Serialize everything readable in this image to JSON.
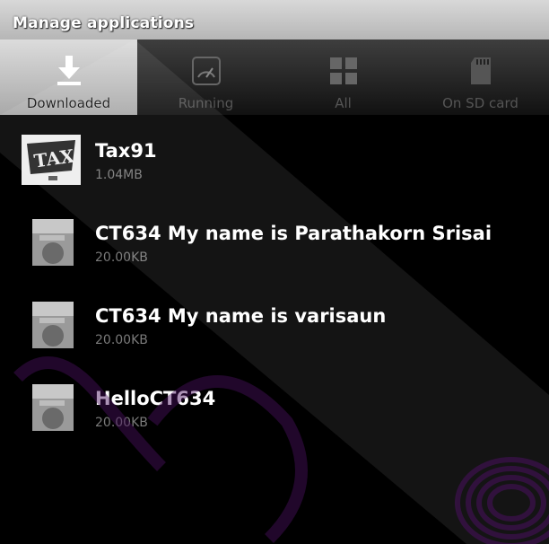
{
  "title_bar": {
    "title": "Manage applications"
  },
  "tabs": [
    {
      "label": "Downloaded",
      "icon": "download-icon",
      "selected": true
    },
    {
      "label": "Running",
      "icon": "speedometer-icon",
      "selected": false
    },
    {
      "label": "All",
      "icon": "grid-icon",
      "selected": false
    },
    {
      "label": "On SD card",
      "icon": "sd-card-icon",
      "selected": false
    }
  ],
  "apps": [
    {
      "name": "Tax91",
      "size": "1.04MB",
      "icon": "tax-app-icon"
    },
    {
      "name": "CT634 My name is Parathakorn Srisai",
      "size": "20.00KB",
      "icon": "default-app-icon"
    },
    {
      "name": "CT634 My name is varisaun",
      "size": "20.00KB",
      "icon": "default-app-icon"
    },
    {
      "name": "HelloCT634",
      "size": "20.00KB",
      "icon": "default-app-icon"
    }
  ],
  "colors": {
    "background": "#000000",
    "tab_selected": "#c8c8c8",
    "watermark": "#5a1a6e"
  }
}
